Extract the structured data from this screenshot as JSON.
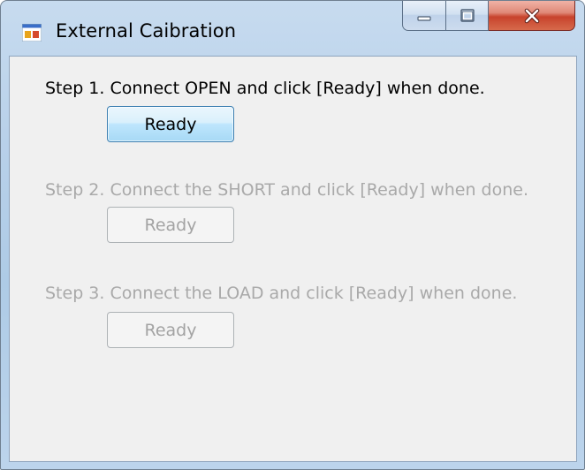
{
  "window": {
    "title": "External Caibration",
    "app_icon": "winforms-app-icon",
    "caption_icons": [
      "minimize-icon",
      "maximize-icon",
      "close-icon"
    ]
  },
  "steps": [
    {
      "text": "Step 1. Connect OPEN and click [Ready] when done.",
      "button_label": "Ready",
      "enabled": true
    },
    {
      "text": "Step 2. Connect the SHORT and click [Ready] when done.",
      "button_label": "Ready",
      "enabled": false
    },
    {
      "text": "Step 3. Connect the LOAD and click [Ready] when done.",
      "button_label": "Ready",
      "enabled": false
    }
  ],
  "colors": {
    "enabled_text": "#000000",
    "disabled_text": "#a9a9a9",
    "button_border_active": "#3c7fb1",
    "close_button": "#c8432c"
  }
}
